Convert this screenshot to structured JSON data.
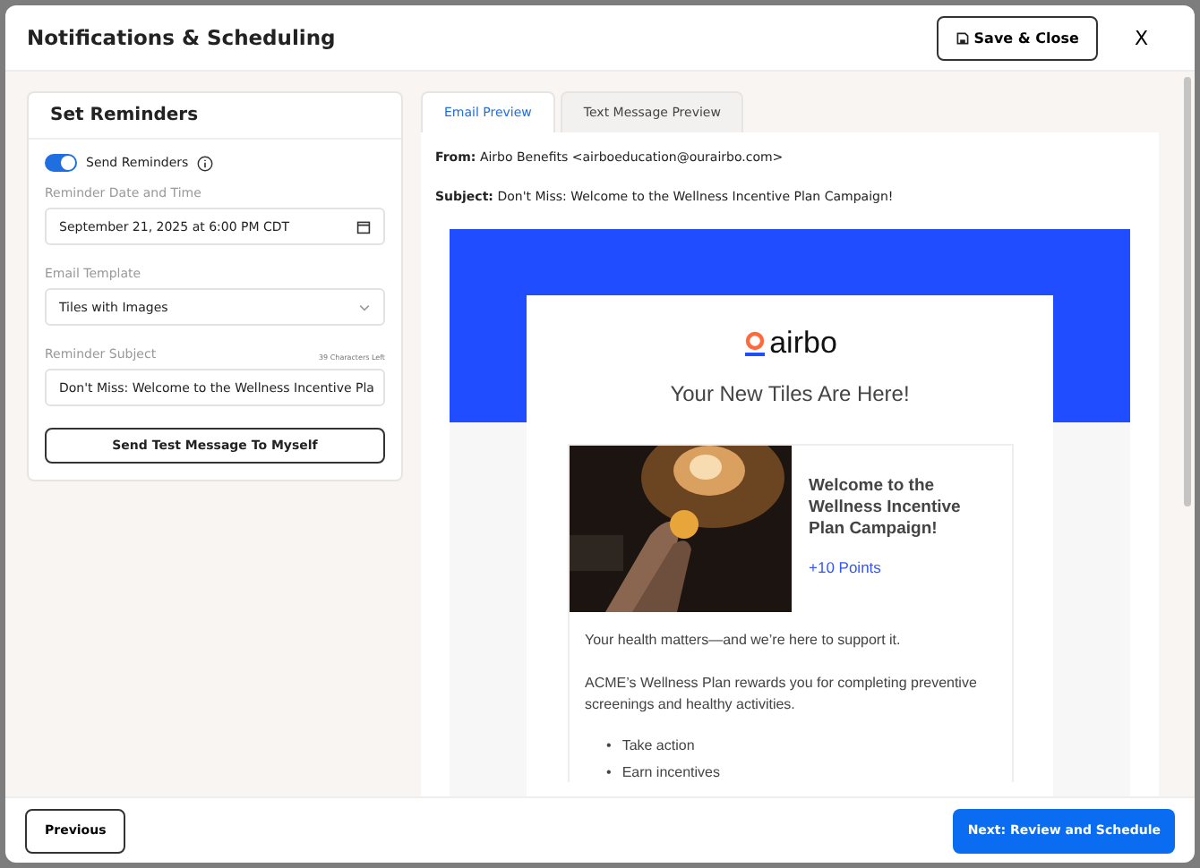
{
  "modal": {
    "title": "Notifications & Scheduling",
    "save_button": "Save & Close",
    "close_button": "X"
  },
  "reminders": {
    "title": "Set Reminders",
    "toggle": {
      "label": "Send Reminders",
      "on": true
    },
    "date": {
      "label": "Reminder Date and Time",
      "value": "September 21, 2025 at 6:00 PM CDT"
    },
    "template": {
      "label": "Email Template",
      "value": "Tiles with Images"
    },
    "subject": {
      "label": "Reminder Subject",
      "counter": "39 Characters Left",
      "value": "Don't Miss: Welcome to the Wellness Incentive Pla"
    },
    "test_button": "Send Test Message To Myself"
  },
  "tabs": [
    {
      "label": "Email Preview",
      "selected": true
    },
    {
      "label": "Text Message Preview",
      "selected": false
    }
  ],
  "preview": {
    "from_label": "From:",
    "from": "Airbo Benefits <airboeducation@ourairbo.com>",
    "subject_label": "Subject:",
    "subject": "Don't Miss: Welcome to the Wellness Incentive Plan Campaign!",
    "logo": "airbo",
    "heading": "Your New Tiles Are Here!",
    "tile": {
      "kind": "picture",
      "title": "Welcome to the Wellness Incentive Plan Campaign!",
      "points": "+10 Points"
    },
    "paragraphs": [
      "Your health matters—and we’re here to support it.",
      "ACME’s Wellness Plan rewards you for completing preventive screenings and healthy activities."
    ],
    "bullets": [
      {
        "marker": "•",
        "text": "Take action"
      },
      {
        "marker": "•",
        "text": "Earn incentives"
      }
    ]
  },
  "footer": {
    "previous": "Previous",
    "next": "Next: Review and Schedule"
  }
}
